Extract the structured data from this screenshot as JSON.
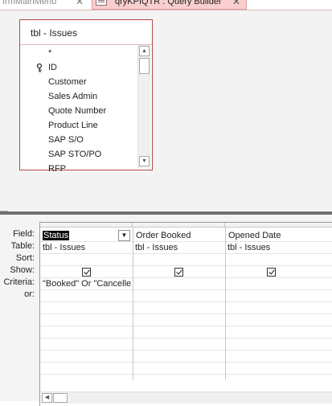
{
  "tabs": [
    {
      "label": "frmMainMenu",
      "active": false
    },
    {
      "label": "qryKPIQTR : Query Builder",
      "active": true
    }
  ],
  "tab_close_glyph": "✕",
  "table_box": {
    "title": "tbl - Issues",
    "fields": [
      "*",
      "ID",
      "Customer",
      "Sales Admin",
      "Quote Number",
      "Product Line",
      "SAP S/O",
      "SAP STO/PO",
      "RFP"
    ],
    "primary_key_field": "ID"
  },
  "grid": {
    "row_labels": {
      "field": "Field:",
      "table": "Table:",
      "sort": "Sort:",
      "show": "Show:",
      "criteria": "Criteria:",
      "or": "or:"
    },
    "columns": [
      {
        "field": "Status",
        "table": "tbl - Issues",
        "show": true,
        "criteria": "\"Booked\" Or \"Cancelle"
      },
      {
        "field": "Order Booked",
        "table": "tbl - Issues",
        "show": true,
        "criteria": ""
      },
      {
        "field": "Opened Date",
        "table": "tbl - Issues",
        "show": true,
        "criteria": ""
      }
    ],
    "dropdown_glyph": "▼"
  },
  "icons": {
    "query-icon": "datasheet",
    "key-icon": "primary key",
    "scroll-up-icon": "▲",
    "scroll-down-icon": "▼",
    "scroll-left-icon": "◀"
  },
  "colors": {
    "active_tab": "#f8cece",
    "table_border": "#b24a4a",
    "selection": "#0a0a0a",
    "splitter": "#6f6f6f"
  }
}
